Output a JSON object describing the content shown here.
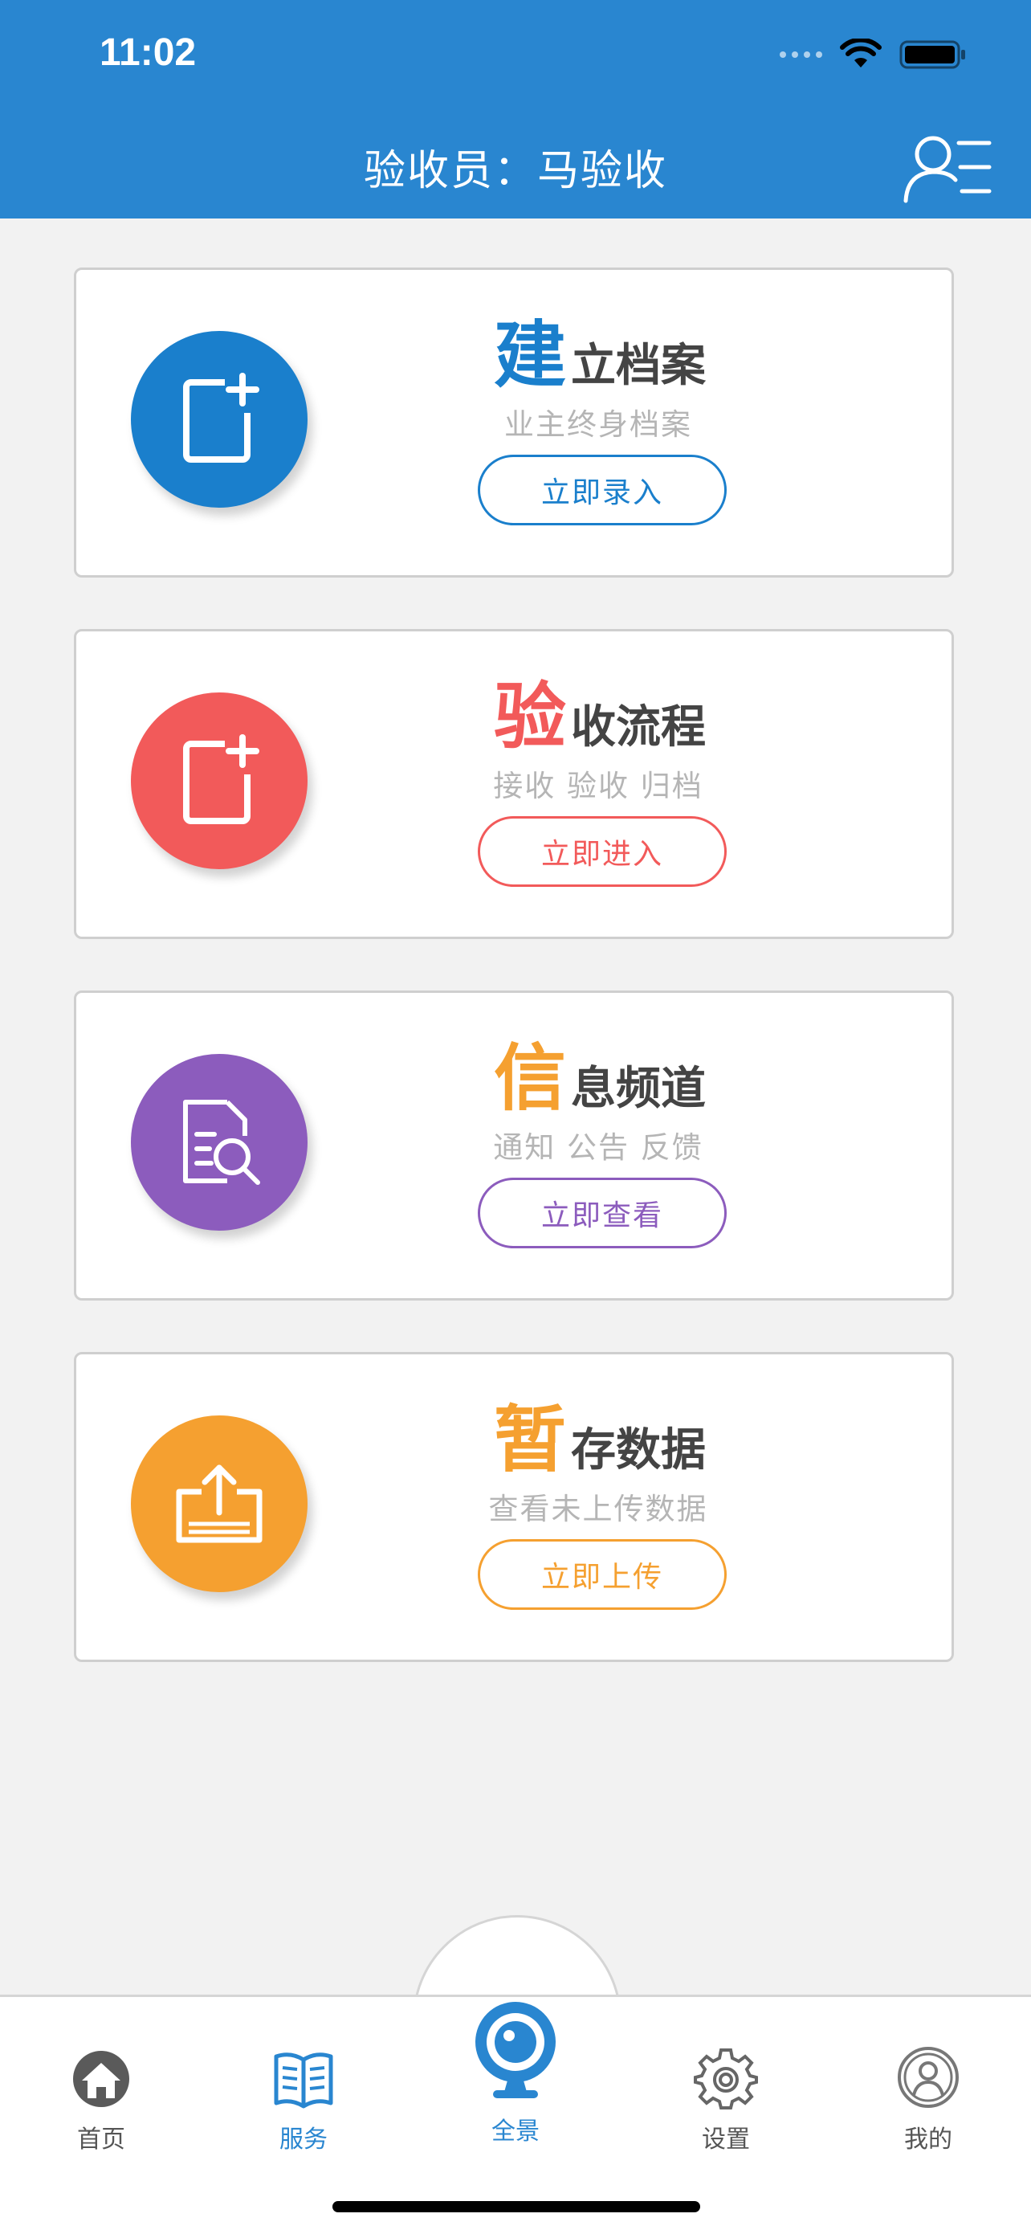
{
  "status_bar": {
    "time": "11:02"
  },
  "header": {
    "title": "验收员：马验收"
  },
  "cards": [
    {
      "first_char": "建",
      "rest": "立档案",
      "subtitle": "业主终身档案",
      "button": "立即录入",
      "color": "#1a7fcc",
      "icon": "add-document-icon"
    },
    {
      "first_char": "验",
      "rest": "收流程",
      "subtitle": "接收 验收 归档",
      "button": "立即进入",
      "color": "#f25a5a",
      "icon": "add-document-icon"
    },
    {
      "first_char": "信",
      "rest": "息频道",
      "subtitle": "通知 公告 反馈",
      "button": "立即查看",
      "color": "#8c5cbd",
      "icon": "document-search-icon"
    },
    {
      "first_char": "暂",
      "rest": "存数据",
      "subtitle": "查看未上传数据",
      "button": "立即上传",
      "color": "#f5a030",
      "icon": "upload-tray-icon"
    }
  ],
  "tabbar": {
    "items": [
      {
        "label": "首页",
        "icon": "home-icon",
        "active": false
      },
      {
        "label": "服务",
        "icon": "book-icon",
        "active": true
      },
      {
        "label": "全景",
        "icon": "webcam-icon",
        "active": false
      },
      {
        "label": "设置",
        "icon": "gear-icon",
        "active": false
      },
      {
        "label": "我的",
        "icon": "user-icon",
        "active": false
      }
    ]
  },
  "colors": {
    "header": "#2986d0",
    "tab_active": "#2986d0",
    "tab_inactive": "#555555"
  }
}
